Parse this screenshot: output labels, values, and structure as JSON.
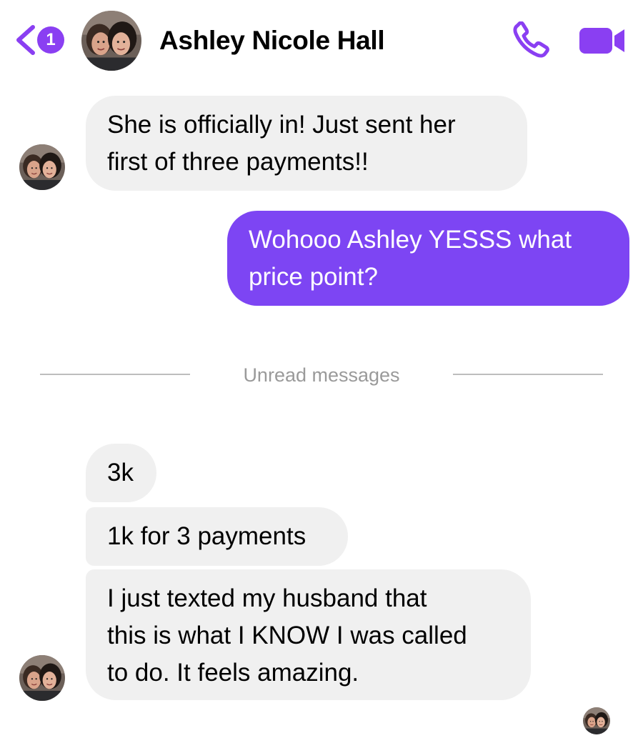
{
  "header": {
    "unread_count": "1",
    "contact_name": "Ashley Nicole Hall",
    "icons": {
      "back": "chevron-left-icon",
      "call": "phone-icon",
      "video": "video-camera-icon"
    }
  },
  "colors": {
    "accent": "#8a3ff2",
    "outgoing_bubble": "#7d45f3",
    "incoming_bubble": "#f0f0f0",
    "divider_text": "#9a9a9a"
  },
  "messages": [
    {
      "direction": "incoming",
      "lines": [
        "She is officially in! Just sent her",
        "first of three payments!!"
      ]
    },
    {
      "direction": "outgoing",
      "lines": [
        "Wohooo Ashley YESSS what",
        "price point?"
      ]
    },
    {
      "direction": "incoming",
      "lines": [
        "3k"
      ]
    },
    {
      "direction": "incoming",
      "lines": [
        "1k for 3 payments"
      ]
    },
    {
      "direction": "incoming",
      "lines": [
        "I just texted my husband that",
        "this is what I KNOW I was called",
        "to do. It feels amazing."
      ]
    }
  ],
  "divider": {
    "label": "Unread messages"
  }
}
